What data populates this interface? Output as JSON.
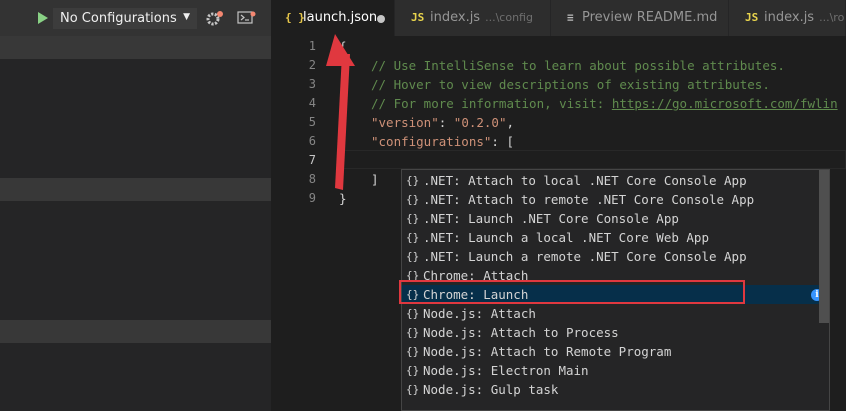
{
  "debug_toolbar": {
    "configuration": "No Configurations",
    "caret": "▼",
    "play_icon": "play-icon",
    "settings_icon": "gear-icon",
    "console_icon": "terminal-icon"
  },
  "tabs": [
    {
      "icon": "{ }",
      "label": "launch.json",
      "sub": "",
      "active": true,
      "dirty": true,
      "icon_color": "#e8c84a"
    },
    {
      "icon": "JS",
      "label": "index.js",
      "sub": "...\\config",
      "active": false,
      "dirty": false,
      "icon_color": "#e8d44d"
    },
    {
      "icon": "≡",
      "label": "Preview README.md",
      "sub": "",
      "active": false,
      "dirty": false,
      "icon_color": "#bbbbbb"
    },
    {
      "icon": "JS",
      "label": "index.js",
      "sub": "...\\rout",
      "active": false,
      "dirty": false,
      "icon_color": "#e8d44d"
    }
  ],
  "editor": {
    "line_numbers": [
      "1",
      "2",
      "3",
      "4",
      "5",
      "6",
      "7",
      "8",
      "9"
    ],
    "current_line": "7",
    "lines": {
      "l1": "{",
      "l2": "// Use IntelliSense to learn about possible attributes.",
      "l3": "// Hover to view descriptions of existing attributes.",
      "l4_prefix": "// For more information, visit: ",
      "l4_link": "https://go.microsoft.com/fwlin",
      "l5_key": "\"version\"",
      "l5_colon": ": ",
      "l5_value": "\"0.2.0\"",
      "l5_comma": ",",
      "l6_key": "\"configurations\"",
      "l6_rest": ": [",
      "l8": "]",
      "l9": "}"
    }
  },
  "suggestions": {
    "braces": "{}",
    "items": [
      ".NET: Attach to local .NET Core Console App",
      ".NET: Attach to remote .NET Core Console App",
      ".NET: Launch .NET Core Console App",
      ".NET: Launch a local .NET Core Web App",
      ".NET: Launch a remote .NET Core Console App",
      "Chrome: Attach",
      "Chrome: Launch",
      "Node.js: Attach",
      "Node.js: Attach to Process",
      "Node.js: Attach to Remote Program",
      "Node.js: Electron Main",
      "Node.js: Gulp task"
    ],
    "selected_index": 6,
    "info_icon": "i"
  },
  "colors": {
    "annotation": "#e0383f"
  }
}
